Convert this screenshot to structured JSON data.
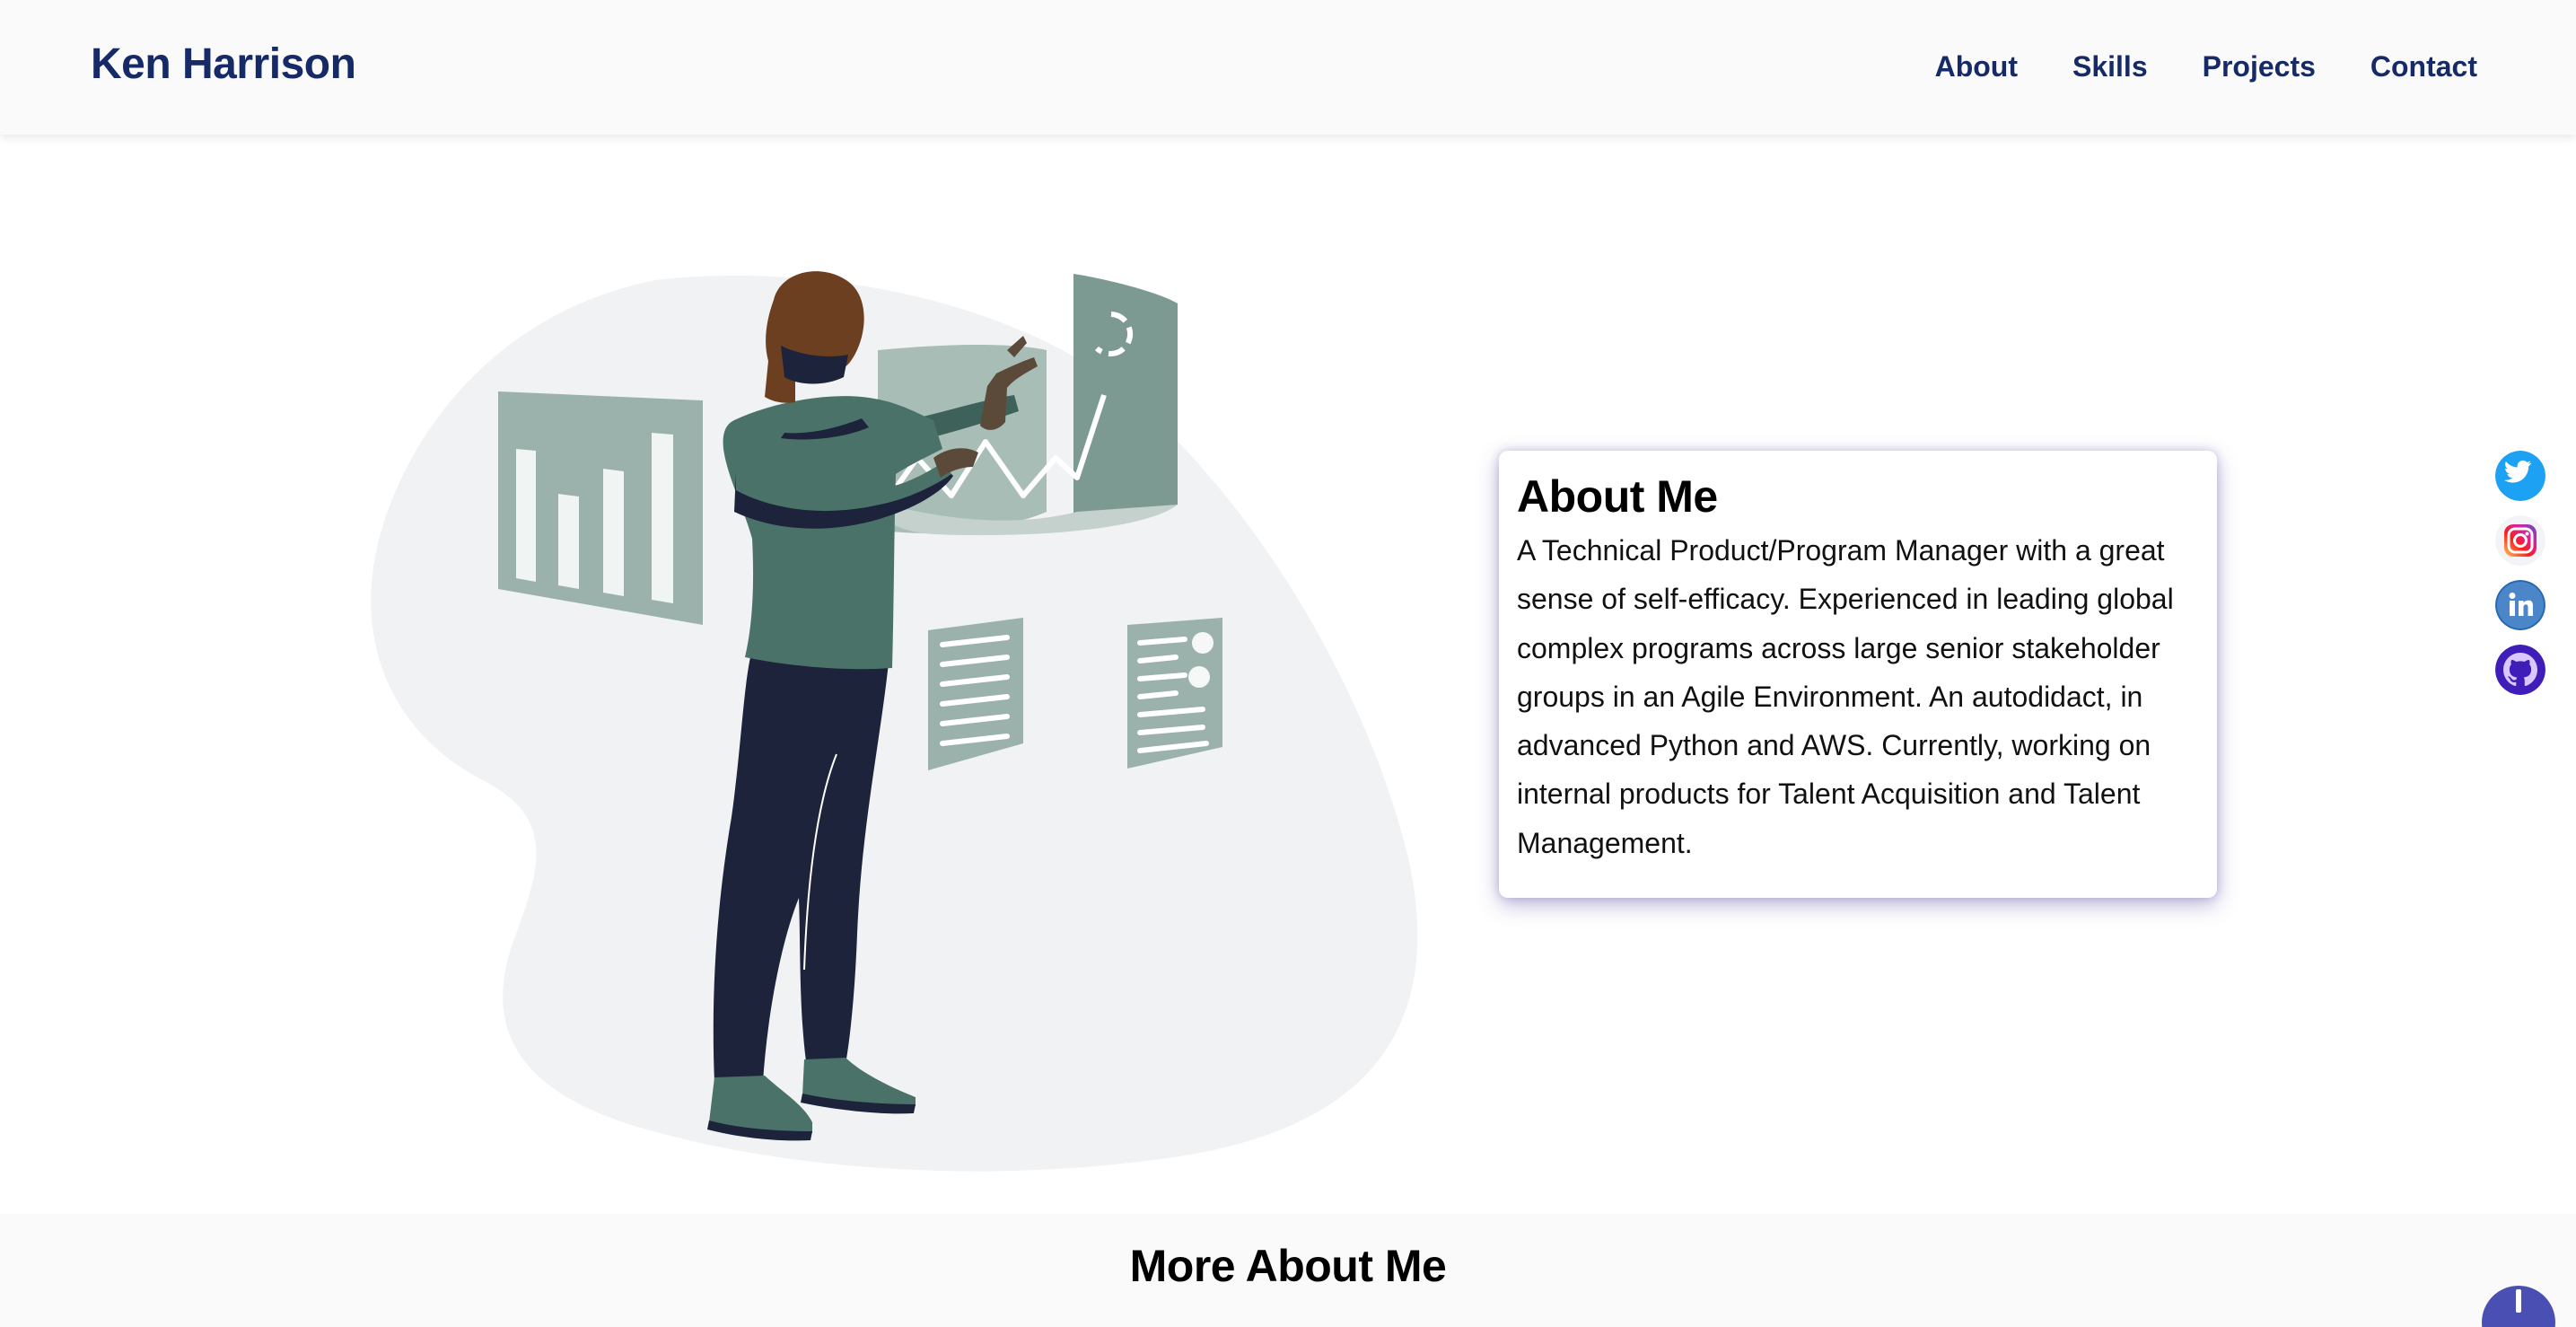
{
  "header": {
    "brand": "Ken Harrison",
    "nav": [
      {
        "label": "About"
      },
      {
        "label": "Skills"
      },
      {
        "label": "Projects"
      },
      {
        "label": "Contact"
      }
    ]
  },
  "about": {
    "title": "About Me",
    "text": "A Technical Product/Program Manager with a great sense of self-efficacy. Experienced in leading global complex programs across large senior stakeholder groups in an Agile Environment. An autodidact, in advanced Python and AWS. Currently, working on internal products for Talent Acquisition and Talent Management."
  },
  "social": [
    {
      "icon": "twitter-icon",
      "color": "#1da1f2"
    },
    {
      "icon": "instagram-icon",
      "color": "#d6249f"
    },
    {
      "icon": "linkedin-icon",
      "color": "#2867b2"
    },
    {
      "icon": "github-icon",
      "color": "#3f1db8"
    }
  ],
  "more": {
    "title": "More About Me"
  },
  "colors": {
    "brand": "#152a66",
    "accent": "#4a4fb3",
    "illustration_green": "#4a7268",
    "illustration_panel": "#7f9c94"
  }
}
